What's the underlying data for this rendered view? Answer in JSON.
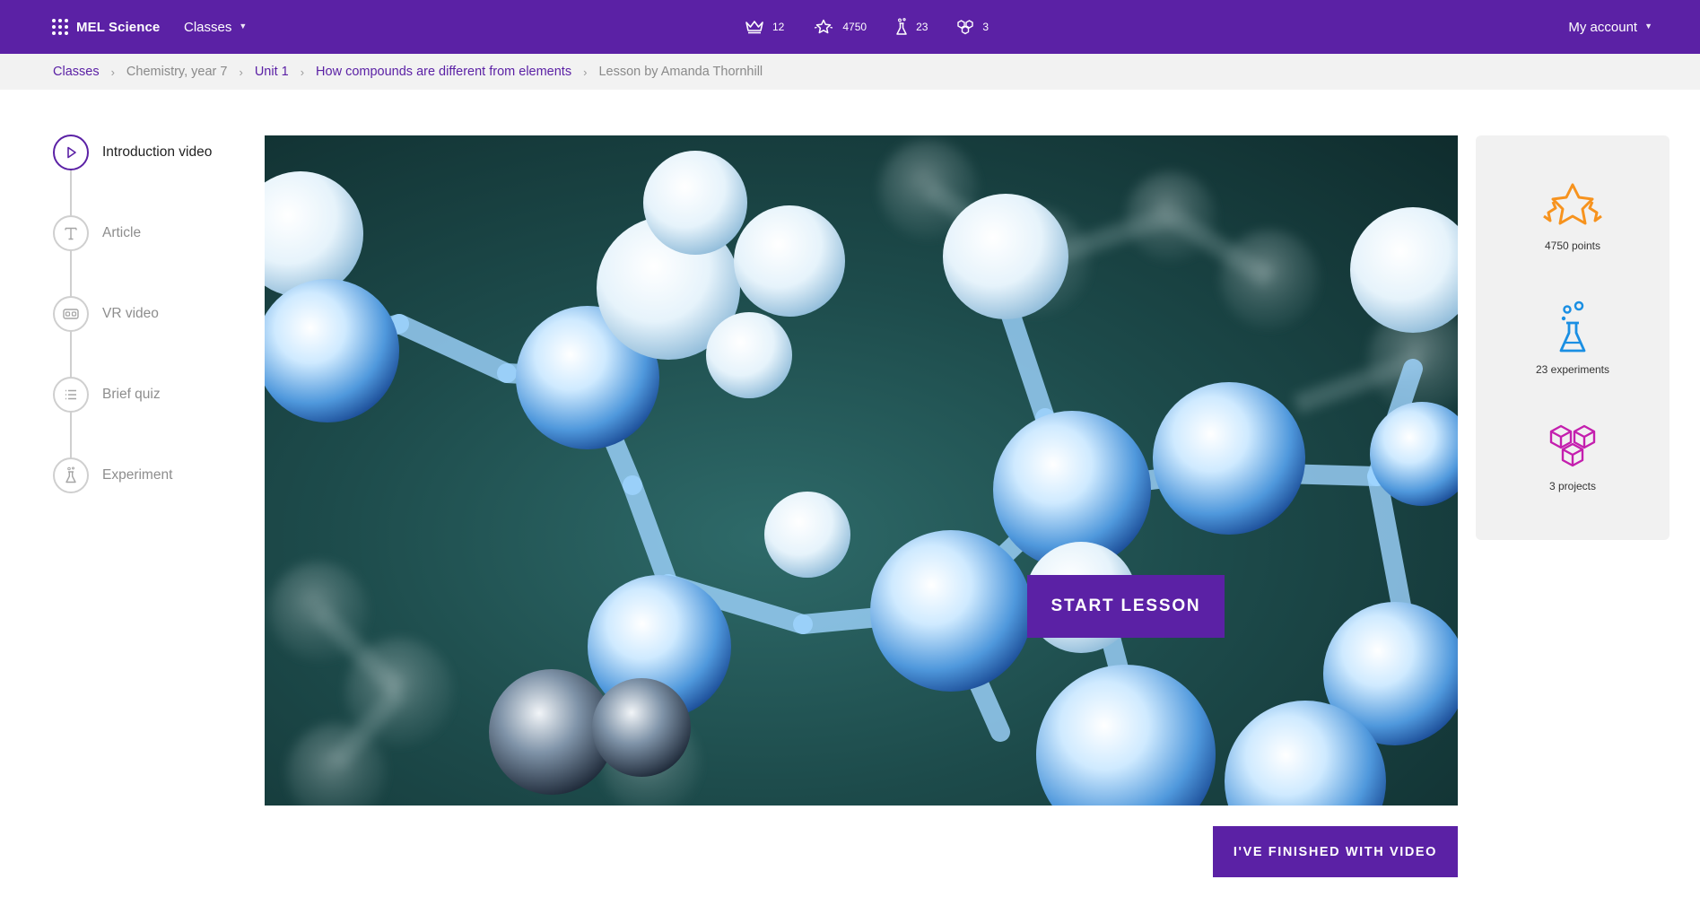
{
  "nav": {
    "brand": "MEL Science",
    "classes_label": "Classes",
    "account_label": "My account",
    "stats": [
      {
        "icon": "crown-icon",
        "value": "12"
      },
      {
        "icon": "stars-icon",
        "value": "4750"
      },
      {
        "icon": "flask-icon",
        "value": "23"
      },
      {
        "icon": "cubes-icon",
        "value": "3"
      }
    ]
  },
  "breadcrumb": [
    {
      "label": "Classes",
      "link": true
    },
    {
      "label": "Chemistry, year 7",
      "link": false
    },
    {
      "label": "Unit 1",
      "link": true
    },
    {
      "label": "How compounds are different from elements",
      "link": true
    },
    {
      "label": "Lesson by Amanda Thornhill",
      "link": false
    }
  ],
  "steps": [
    {
      "label": "Introduction video",
      "icon": "play-icon",
      "active": true
    },
    {
      "label": "Article",
      "icon": "text-icon",
      "active": false
    },
    {
      "label": "VR video",
      "icon": "vr-headset-icon",
      "active": false
    },
    {
      "label": "Brief quiz",
      "icon": "list-icon",
      "active": false
    },
    {
      "label": "Experiment",
      "icon": "experiment-icon",
      "active": false
    }
  ],
  "video": {
    "start_label": "START LESSON"
  },
  "finish_label": "I'VE FINISHED WITH VIDEO",
  "summary": {
    "points_label": "4750 points",
    "experiments_label": "23 experiments",
    "projects_label": "3 projects"
  },
  "colors": {
    "brand_purple": "#5b21a5",
    "star_orange": "#f7931e",
    "flask_blue": "#1a8fe3",
    "cubes_magenta": "#c41fae"
  }
}
